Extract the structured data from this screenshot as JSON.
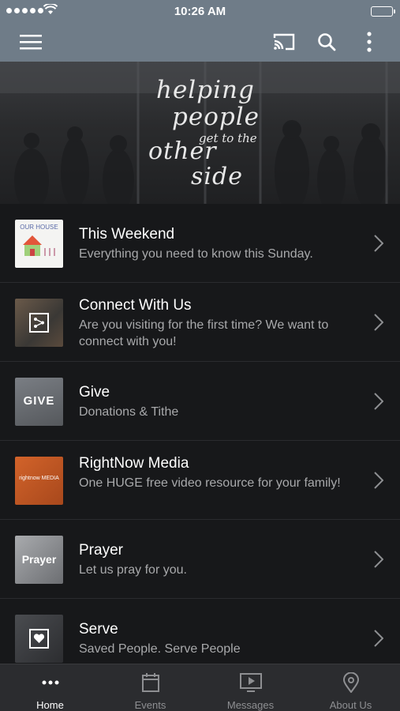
{
  "status_bar": {
    "time": "10:26 AM"
  },
  "hero": {
    "tagline_lines": [
      "helping",
      "people",
      "get to the",
      "other",
      "side"
    ]
  },
  "items": [
    {
      "title": "This Weekend",
      "subtitle": "Everything you need to know this Sunday.",
      "thumb_text": "OUR HOUSE",
      "thumb_icon": "house-drawing"
    },
    {
      "title": "Connect With Us",
      "subtitle": "Are you visiting for the first time? We want to connect with you!",
      "thumb_icon": "share-icon"
    },
    {
      "title": "Give",
      "subtitle": "Donations & Tithe",
      "thumb_text": "GIVE"
    },
    {
      "title": "RightNow Media",
      "subtitle": "One HUGE free video resource for your family!",
      "thumb_text": "rightnow MEDIA"
    },
    {
      "title": "Prayer",
      "subtitle": "Let us pray for you.",
      "thumb_text": "Prayer"
    },
    {
      "title": "Serve",
      "subtitle": "Saved People. Serve People",
      "thumb_icon": "heart-frame-icon"
    }
  ],
  "tabs": [
    {
      "label": "Home",
      "icon": "more-dots-icon",
      "active": true
    },
    {
      "label": "Events",
      "icon": "calendar-icon",
      "active": false
    },
    {
      "label": "Messages",
      "icon": "video-play-icon",
      "active": false
    },
    {
      "label": "About Us",
      "icon": "location-pin-icon",
      "active": false
    }
  ],
  "colors": {
    "nav_bar": "#6f7c88",
    "background": "#17181a",
    "tab_bar": "#2b2c2f",
    "subtitle": "#a8a9ab"
  }
}
